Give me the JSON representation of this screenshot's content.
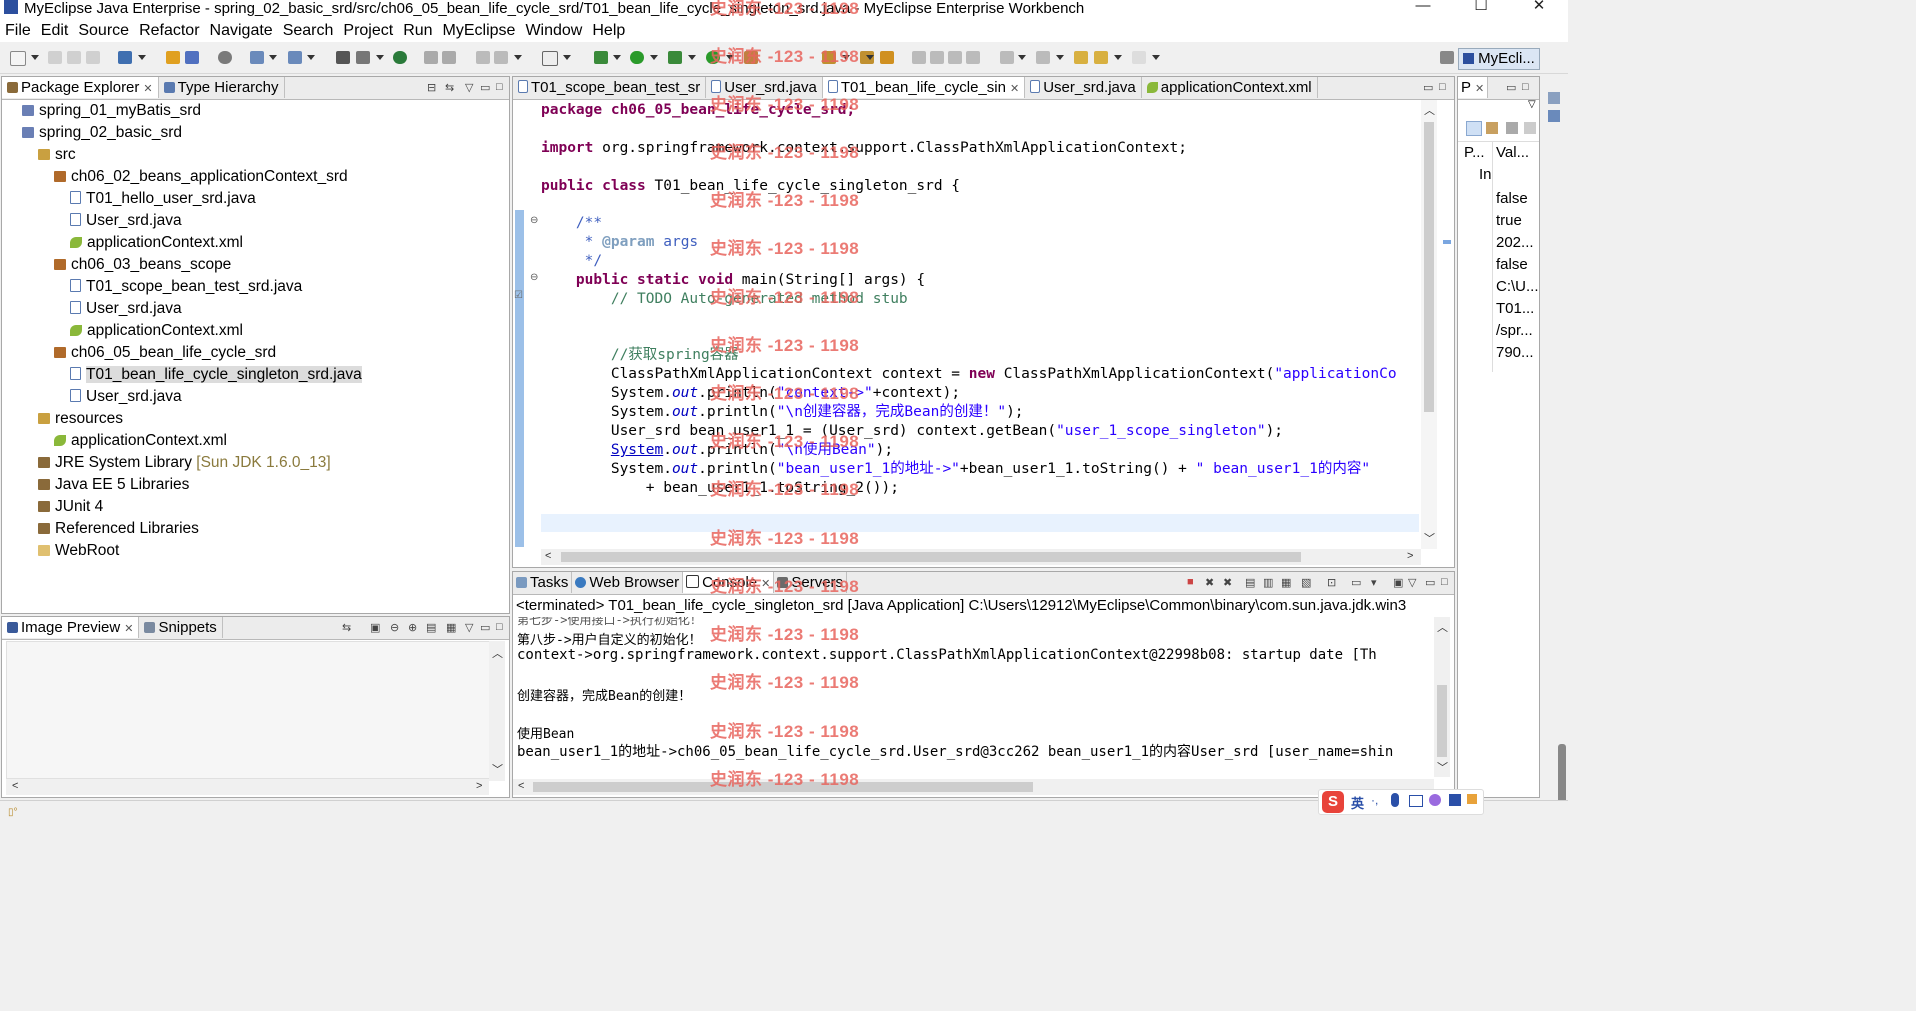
{
  "window": {
    "title": "MyEclipse Java Enterprise - spring_02_basic_srd/src/ch06_05_bean_life_cycle_srd/T01_bean_life_cycle_singleton_srd.java - MyEclipse Enterprise Workbench",
    "minimize": "—",
    "maximize": "☐",
    "close": "✕"
  },
  "menu": [
    "File",
    "Edit",
    "Source",
    "Refactor",
    "Navigate",
    "Search",
    "Project",
    "Run",
    "MyEclipse",
    "Window",
    "Help"
  ],
  "perspective": {
    "label": "MyEcli..."
  },
  "package_explorer": {
    "tabs": [
      "Package Explorer",
      "Type Hierarchy"
    ],
    "tree": [
      {
        "label": "spring_01_myBatis_srd",
        "icon": "project-icon"
      },
      {
        "label": "spring_02_basic_srd",
        "icon": "project-icon"
      },
      {
        "label": "src",
        "icon": "source-folder-icon"
      },
      {
        "label": "ch06_02_beans_applicationContext_srd",
        "icon": "package-icon"
      },
      {
        "label": "T01_hello_user_srd.java",
        "icon": "java-file-icon"
      },
      {
        "label": "User_srd.java",
        "icon": "java-file-icon"
      },
      {
        "label": "applicationContext.xml",
        "icon": "xml-file-icon"
      },
      {
        "label": "ch06_03_beans_scope",
        "icon": "package-icon"
      },
      {
        "label": "T01_scope_bean_test_srd.java",
        "icon": "java-file-icon"
      },
      {
        "label": "User_srd.java",
        "icon": "java-file-icon"
      },
      {
        "label": "applicationContext.xml",
        "icon": "xml-file-icon"
      },
      {
        "label": "ch06_05_bean_life_cycle_srd",
        "icon": "package-icon"
      },
      {
        "label": "T01_bean_life_cycle_singleton_srd.java",
        "icon": "java-file-icon",
        "selected": true
      },
      {
        "label": "User_srd.java",
        "icon": "java-file-icon"
      },
      {
        "label": "resources",
        "icon": "source-folder-icon"
      },
      {
        "label": "applicationContext.xml",
        "icon": "xml-file-icon"
      },
      {
        "label": "JRE System Library",
        "decoration": "[Sun JDK 1.6.0_13]",
        "icon": "library-icon"
      },
      {
        "label": "Java EE 5 Libraries",
        "icon": "library-icon"
      },
      {
        "label": "JUnit 4",
        "icon": "library-icon"
      },
      {
        "label": "Referenced Libraries",
        "icon": "library-icon"
      },
      {
        "label": "WebRoot",
        "icon": "folder-icon"
      }
    ]
  },
  "image_preview": {
    "tabs": [
      "Image Preview",
      "Snippets"
    ]
  },
  "editor": {
    "tabs": [
      "T01_scope_bean_test_sr",
      "User_srd.java",
      "T01_bean_life_cycle_sin",
      "User_srd.java",
      "applicationContext.xml"
    ],
    "active_tab_index": 2,
    "lines": {
      "l1": "package ch06_05_bean_life_cycle_srd;",
      "l2a": "import ",
      "l2b": "org.springframework.context.support.ClassPathXmlApplicationContext;",
      "l3a": "public class ",
      "l3b": "T01_bean_life_cycle_singleton_srd {",
      "l4": "    /**",
      "l5a": "     * ",
      "l5b": "@param",
      "l5c": " args",
      "l6": "     */",
      "l7a": "    public static void ",
      "l7b": "main(String[] args) {",
      "l8": "        // TODO Auto-generated method stub",
      "l9": "        //获取spring容器",
      "l10a": "        ClassPathXmlApplicationContext context = ",
      "l10b": "new",
      "l10c": " ClassPathXmlApplicationContext(",
      "l10d": "\"applicationCo",
      "l11a": "        System.",
      "l11b": "out",
      "l11c": ".println(",
      "l11d": "\"context->\"",
      "l11e": "+context);",
      "l12a": "        System.",
      "l12b": "out",
      "l12c": ".println(",
      "l12d": "\"\\n创建容器，完成Bean的创建！\"",
      "l12e": ");",
      "l13a": "        User_srd bean_user1_1 = (User_srd) context.getBean(",
      "l13b": "\"user_1_scope_singleton\"",
      "l13c": ");",
      "l14a": "        ",
      "l14b": "System",
      "l14c": ".",
      "l14d": "out",
      "l14e": ".println(",
      "l14f": "\"\\n使用Bean\"",
      "l14g": ");",
      "l15a": "        System.",
      "l15b": "out",
      "l15c": ".println(",
      "l15d": "\"bean_user1_1的地址->\"",
      "l15e": "+bean_user1_1.toString() + ",
      "l15f": "\" bean_user1_1的内容\"",
      "l16": "            + bean_user1_1.toString_2());"
    }
  },
  "properties": {
    "tab": "P",
    "headers": [
      "P...",
      "Val..."
    ],
    "subheader": "In",
    "values": [
      "false",
      "true",
      "202...",
      "false",
      "C:\\U...",
      "T01...",
      "/spr...",
      "790..."
    ]
  },
  "console": {
    "tabs": [
      "Tasks",
      "Web Browser",
      "Console",
      "Servers"
    ],
    "header": "<terminated> T01_bean_life_cycle_singleton_srd [Java Application] C:\\Users\\12912\\MyEclipse\\Common\\binary\\com.sun.java.jdk.win3",
    "lines": [
      "第七步->使用接口->执行初始化！",
      "第八步->用户自定义的初始化！",
      "context->org.springframework.context.support.ClassPathXmlApplicationContext@22998b08: startup date [Th",
      "",
      "创建容器，完成Bean的创建！",
      "",
      "使用Bean",
      "bean_user1_1的地址->ch06_05_bean_life_cycle_srd.User_srd@3cc262 bean_user1_1的内容User_srd [user_name=shin"
    ]
  },
  "watermark": "史润东 -123 - 1198",
  "ime": {
    "label": "英"
  },
  "colors": {
    "selection": "#dcdcdc",
    "keyword": "#7f0055",
    "string": "#2a00ff",
    "comment": "#3f7f5f",
    "watermark": "#e8655e"
  }
}
